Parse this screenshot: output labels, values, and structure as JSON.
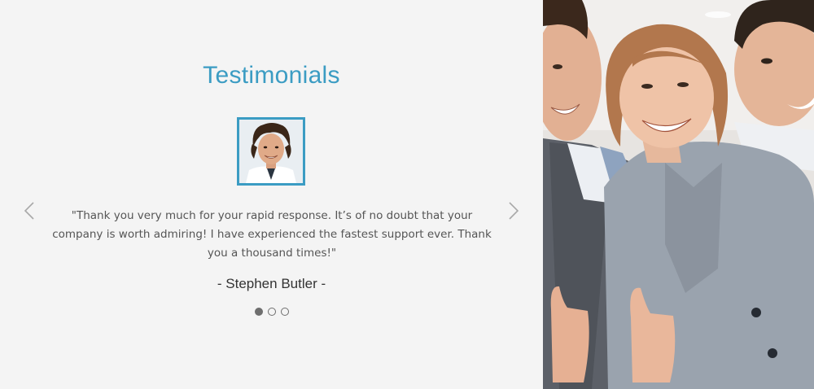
{
  "testimonials": {
    "title": "Testimonials",
    "quote": "\"Thank you very much for your rapid response. It’s of no doubt that your company is worth admiring! I have experienced the fastest support ever. Thank you a thousand times!\"",
    "author": "- Stephen Butler -",
    "prev_icon": "chevron-left-icon",
    "next_icon": "chevron-right-icon",
    "pagination": {
      "total": 3,
      "active_index": 0
    }
  },
  "colors": {
    "accent": "#3b9cc3",
    "background": "#f4f4f4",
    "text": "#555555",
    "author_text": "#333333",
    "dot": "#6e6e6e"
  }
}
